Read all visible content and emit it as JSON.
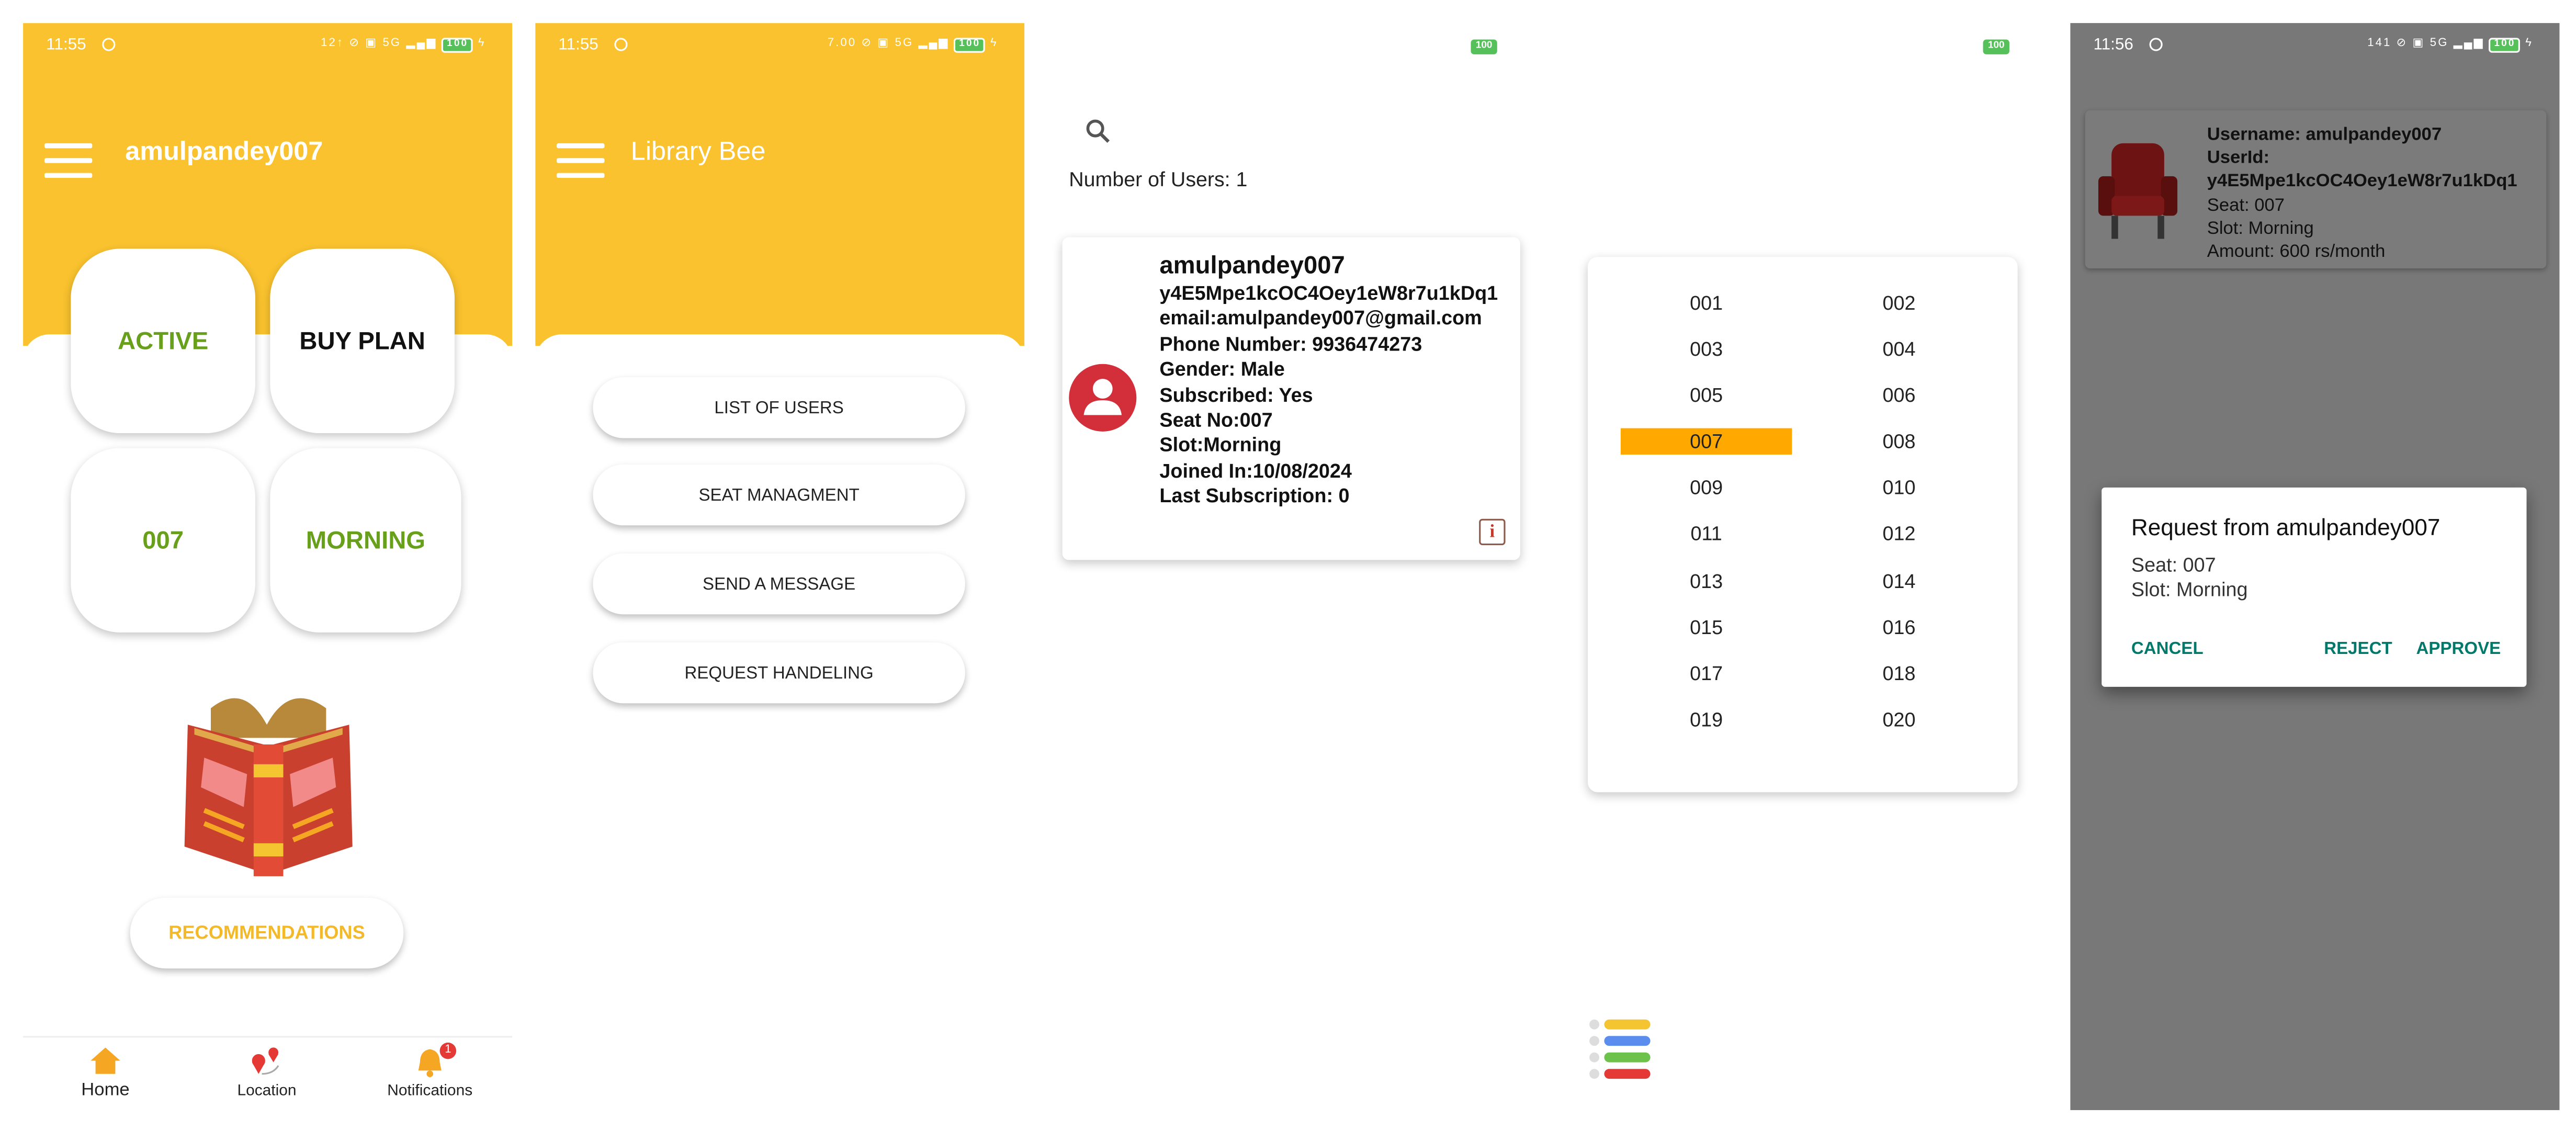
{
  "colors": {
    "yellow": "#f9c22e",
    "green": "#689f1b",
    "teal": "#00796b",
    "highlight": "#ffa800",
    "overlay": "#777777",
    "red_badge": "#e53935"
  },
  "screen1": {
    "status_time": "11:55",
    "status_icons": "12↑ ⊘ ▣ 5G ▂▄▆",
    "battery": "100",
    "username": "amulpandey007",
    "tiles": {
      "status": "ACTIVE",
      "plan": "BUY PLAN",
      "seat": "007",
      "slot": "MORNING"
    },
    "book_illustration": "open-book-icon",
    "recommendations_label": "RECOMMENDATIONS",
    "nav": [
      {
        "label": "Home",
        "icon": "home-icon"
      },
      {
        "label": "Location",
        "icon": "location-pins-icon"
      },
      {
        "label": "Notifications",
        "icon": "bell-icon",
        "badge": "1"
      }
    ]
  },
  "screen2": {
    "status_time": "11:55",
    "status_icons": "7.00 ⊘ ▣ 5G ▂▄▆",
    "battery": "100",
    "title": "Library Bee",
    "menu": [
      "LIST OF USERS",
      "SEAT MANAGMENT",
      "SEND A MESSAGE",
      "REQUEST HANDELING"
    ]
  },
  "screen3": {
    "battery": "100",
    "search_icon": "search-icon",
    "user_count_text": "Number of Users: 1",
    "user": {
      "name": "amulpandey007",
      "id": "y4E5Mpe1kcOC4Oey1eW8r7u1kDq1",
      "email": "email:amulpandey007@gmail.com",
      "phone": "Phone Number: 9936474273",
      "gender": "Gender: Male",
      "subscribed": "Subscribed: Yes",
      "seat": "Seat No:007",
      "slot": "Slot:Morning",
      "joined": "Joined In:10/08/2024",
      "last_sub": "Last Subscription: 0"
    },
    "info_icon": "info-icon"
  },
  "screen4": {
    "battery": "100",
    "seats": [
      "001",
      "002",
      "003",
      "004",
      "005",
      "006",
      "007",
      "008",
      "009",
      "010",
      "011",
      "012",
      "013",
      "014",
      "015",
      "016",
      "017",
      "018",
      "019",
      "020"
    ],
    "selected_seat": "007",
    "list_icon": "colored-list-icon"
  },
  "screen5": {
    "status_time": "11:56",
    "status_icons": "141 ⊘ ▣ 5G ▂▄▆",
    "battery": "100",
    "request_card": {
      "username": "Username: amulpandey007",
      "userid_label": "UserId:",
      "userid": "y4E5Mpe1kcOC4Oey1eW8r7u1kDq1",
      "seat": "Seat: 007",
      "slot": "Slot: Morning",
      "amount": "Amount: 600 rs/month"
    },
    "dialog": {
      "title": "Request from amulpandey007",
      "seat": "Seat: 007",
      "slot": "Slot: Morning",
      "cancel": "CANCEL",
      "reject": "REJECT",
      "approve": "APPROVE"
    }
  }
}
